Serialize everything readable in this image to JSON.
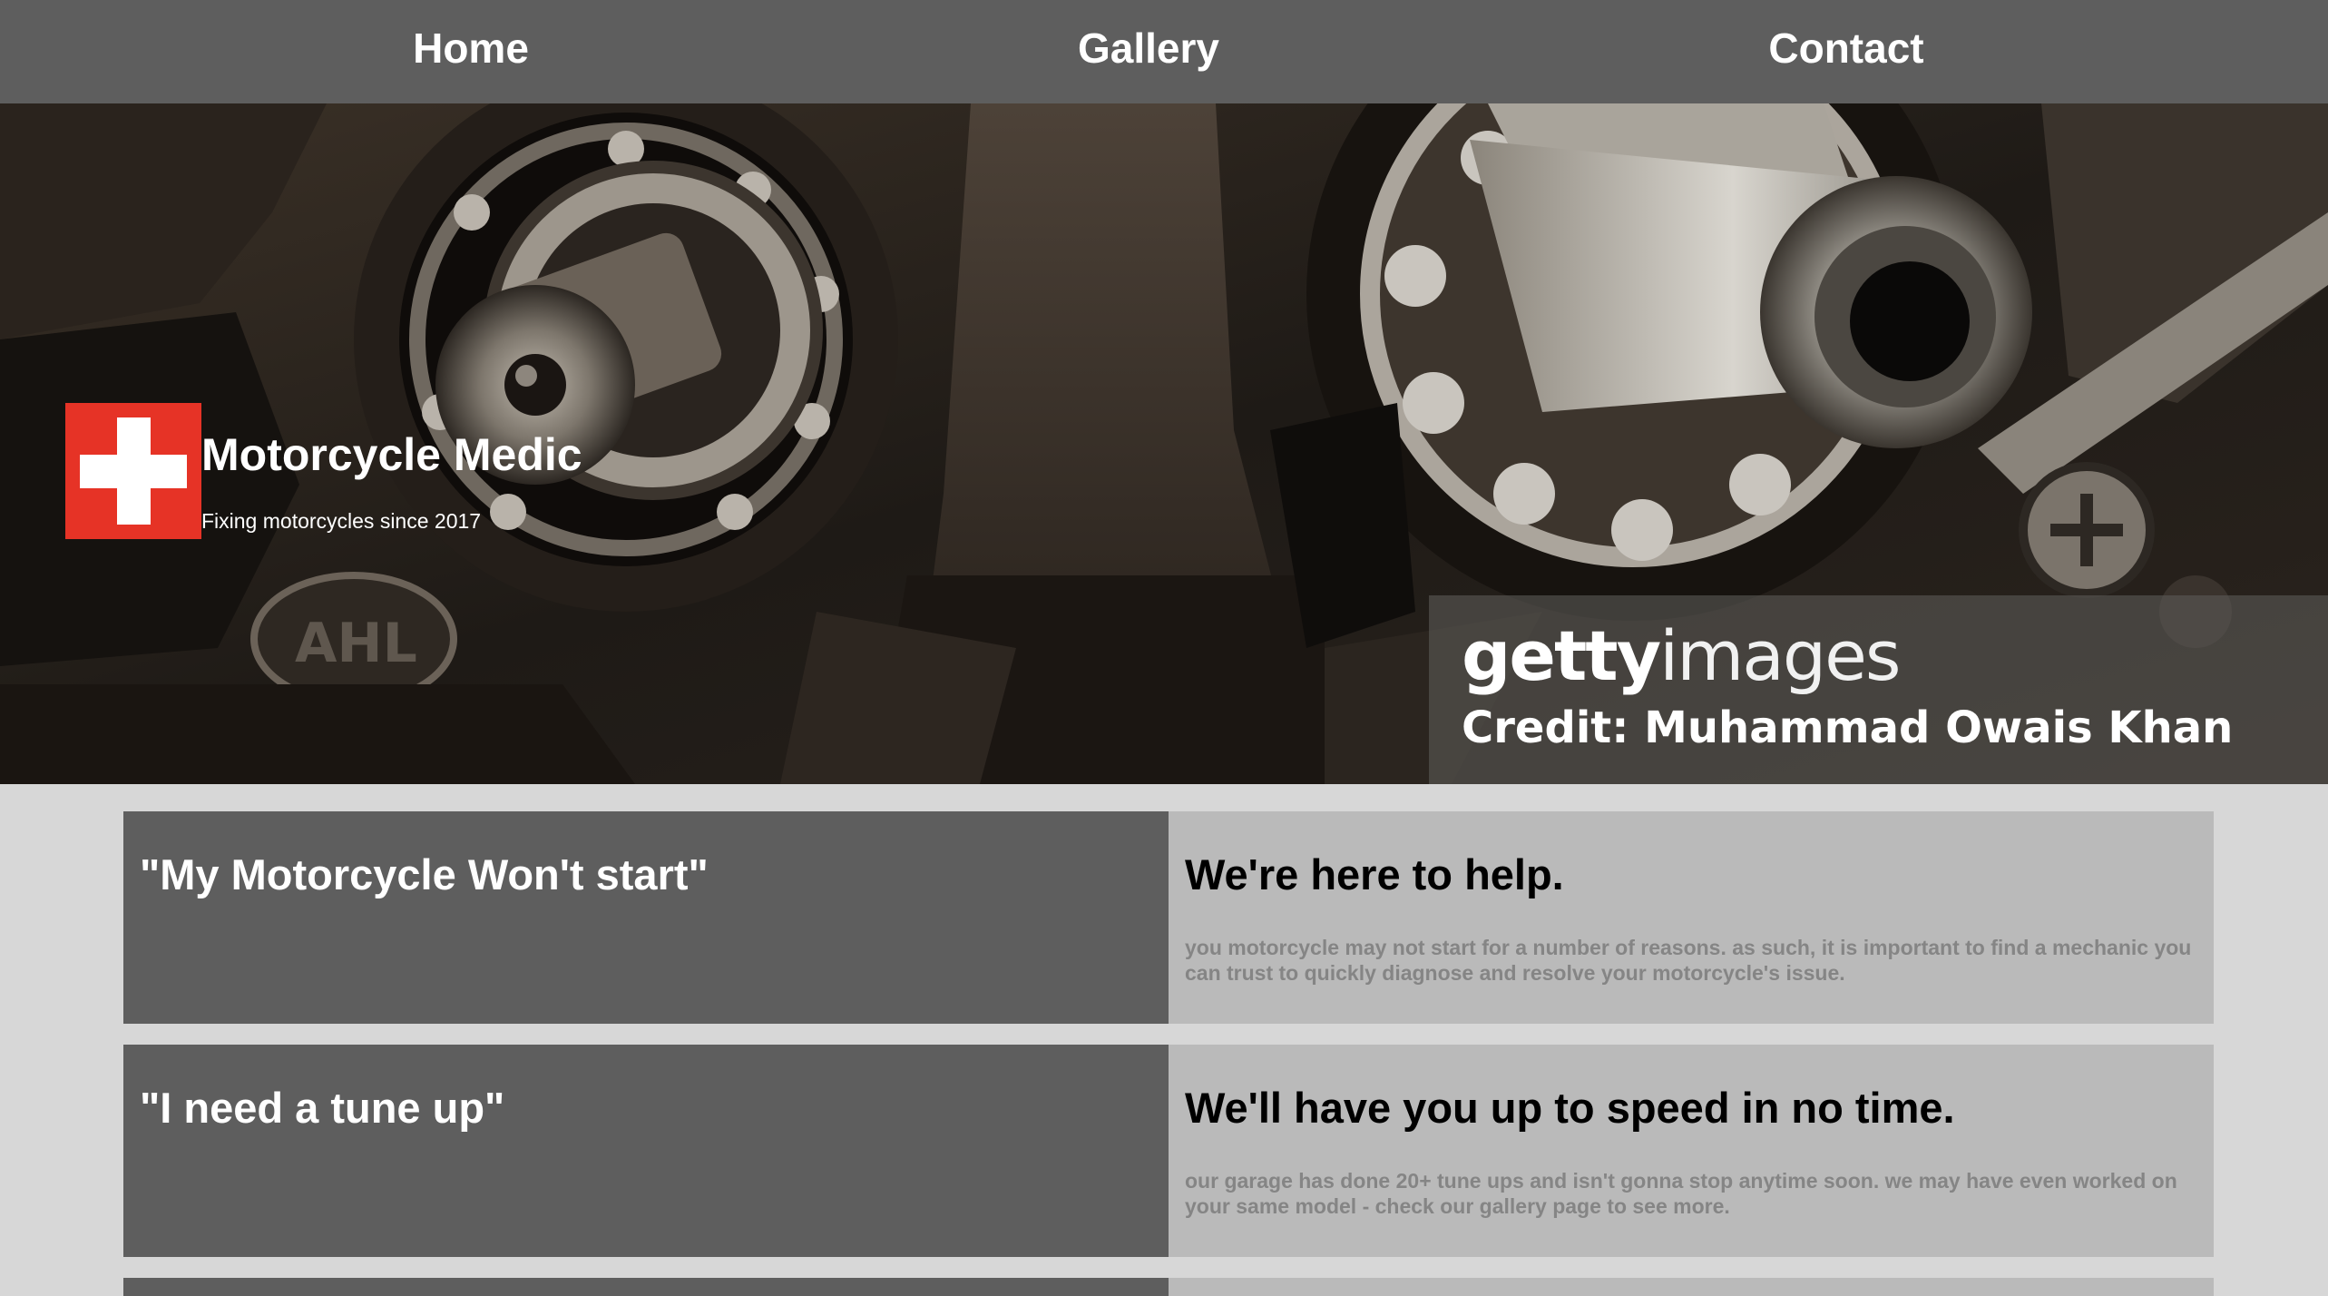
{
  "nav": {
    "items": [
      {
        "label": "Home"
      },
      {
        "label": "Gallery"
      },
      {
        "label": "Contact"
      }
    ]
  },
  "hero": {
    "logo_icon": "medical-cross-icon",
    "title": "Motorcycle Medic",
    "tagline": "Fixing motorcycles since 2017",
    "watermark": {
      "brand_bold": "getty",
      "brand_light": "images",
      "credit": "Credit: Muhammad Owais Khan"
    }
  },
  "rows": [
    {
      "quote": "\"My Motorcycle Won't start\"",
      "answer": "We're here to help.",
      "description": "you motorcycle may not start for a number of reasons. as such, it is important to find a mechanic you can trust to quickly diagnose and resolve your motorcycle's issue."
    },
    {
      "quote": "\"I need a tune up\"",
      "answer": "We'll have you up to speed in no time.",
      "description": "our garage has done 20+ tune ups and isn't gonna stop anytime soon. we may have even worked on your same model - check our gallery page to see more."
    },
    {
      "quote": "",
      "answer": "",
      "description": ""
    }
  ],
  "colors": {
    "nav_bg": "#5e5e5e",
    "page_bg": "#d7d7d7",
    "row_left_bg": "#5e5e5e",
    "row_right_bg": "#bababa",
    "logo_red": "#e63326",
    "desc_text": "#858585"
  }
}
